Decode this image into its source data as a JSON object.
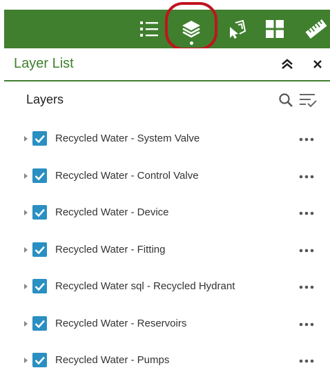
{
  "toolbar": {
    "buttons": [
      {
        "icon": "legend-list-icon"
      },
      {
        "icon": "layers-icon",
        "active": true
      },
      {
        "icon": "select-icon"
      },
      {
        "icon": "basemap-gallery-icon"
      },
      {
        "icon": "measure-ruler-icon"
      }
    ],
    "color": "#3f7f2e",
    "highlight_color": "#c0141f"
  },
  "panel": {
    "title": "Layer List",
    "collapse_icon": "chevron-double-up-icon",
    "close_icon": "close-icon"
  },
  "layers_section": {
    "heading": "Layers",
    "search_icon": "search-icon",
    "filter_icon": "sort-filter-icon"
  },
  "layers": [
    {
      "label": "Recycled Water - System Valve",
      "checked": true
    },
    {
      "label": "Recycled Water - Control Valve",
      "checked": true
    },
    {
      "label": "Recycled Water - Device",
      "checked": true
    },
    {
      "label": "Recycled Water - Fitting",
      "checked": true
    },
    {
      "label": "Recycled Water sql - Recycled Hydrant",
      "checked": true
    },
    {
      "label": "Recycled Water - Reservoirs",
      "checked": true
    },
    {
      "label": "Recycled Water - Pumps",
      "checked": true
    }
  ],
  "checkbox_color": "#2a8fc2"
}
